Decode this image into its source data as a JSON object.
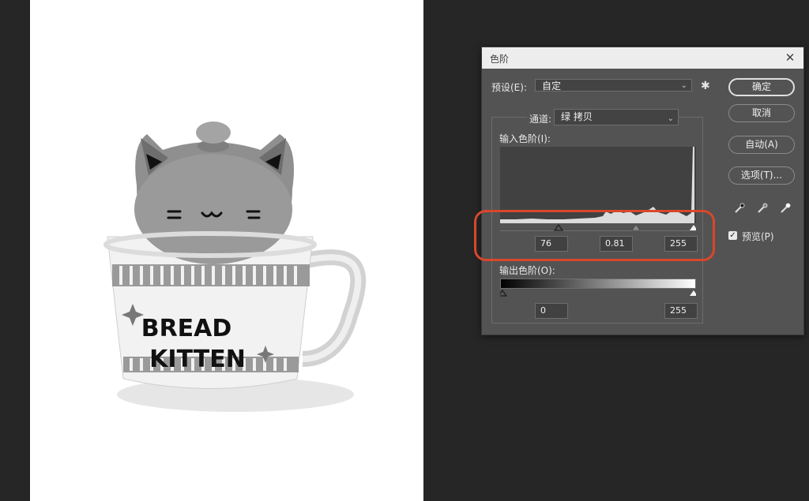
{
  "dialog": {
    "title": "色阶",
    "preset_label": "预设(E):",
    "preset_value": "自定",
    "channel_label": "通道:",
    "channel_value": "绿 拷贝",
    "input_levels_label": "输入色阶(I):",
    "input_levels": {
      "black": "76",
      "gamma": "0.81",
      "white": "255"
    },
    "output_levels_label": "输出色阶(O):",
    "output_levels": {
      "black": "0",
      "white": "255"
    },
    "buttons": {
      "ok": "确定",
      "cancel": "取消",
      "auto": "自动(A)",
      "options": "选项(T)..."
    },
    "preview_label": "预览(P)",
    "preview_checked": true
  },
  "image": {
    "cup_text_line1": "BREAD",
    "cup_text_line2": "KITTEN"
  },
  "highlight_color": "#d9472b",
  "icons": [
    "close-icon",
    "gear-icon",
    "chevron-down-icon",
    "black-eyedropper-icon",
    "gray-eyedropper-icon",
    "white-eyedropper-icon",
    "checkbox-check-icon"
  ]
}
